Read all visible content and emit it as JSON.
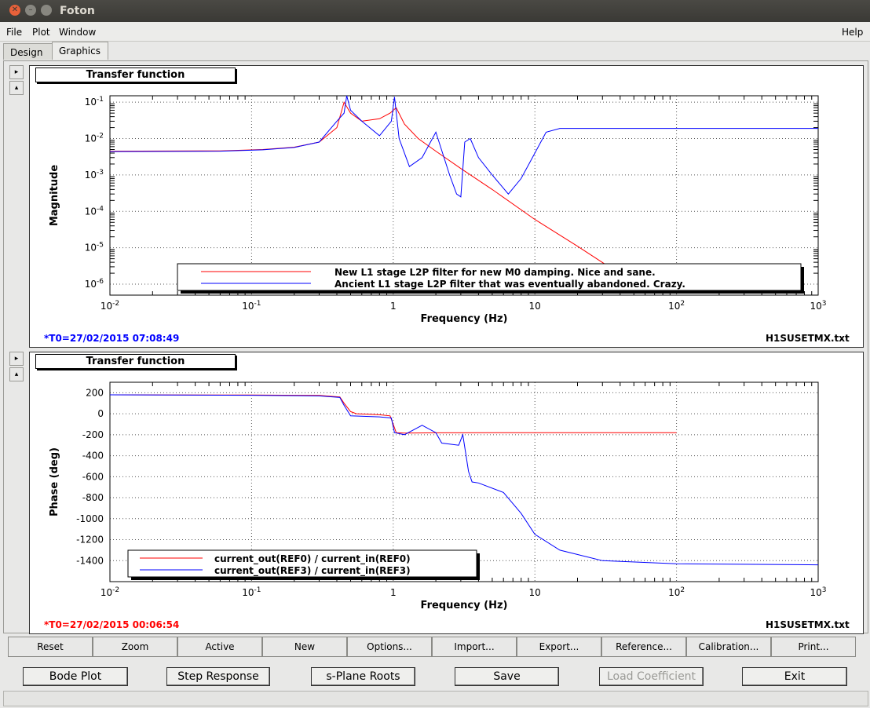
{
  "window": {
    "title": "Foton"
  },
  "menu": {
    "file": "File",
    "plot": "Plot",
    "window": "Window",
    "help": "Help"
  },
  "tabs": [
    {
      "label": "Design"
    },
    {
      "label": "Graphics"
    }
  ],
  "side_buttons": {
    "expand": "▸",
    "collapse": "▴"
  },
  "plots": [
    {
      "panel_title": "Transfer function",
      "t0": "*T0=27/02/2015 07:08:49",
      "t0_color": "#0000ff",
      "file": "H1SUSETMX.txt",
      "chart_data": {
        "type": "line",
        "ylabel": "Magnitude",
        "xlabel": "Frequency (Hz)",
        "xscale": "log",
        "yscale": "log",
        "xlim": [
          0.01,
          1000
        ],
        "ylim": [
          5e-07,
          0.15
        ],
        "x_ticks": [
          "10-2",
          "10-1",
          "1",
          "10",
          "102",
          "103"
        ],
        "y_ticks": [
          "10-1",
          "10-2",
          "10-3",
          "10-4",
          "10-5",
          "10-6"
        ],
        "grid": true,
        "legend": "bottom-center",
        "series": [
          {
            "name": "New L1 stage L2P filter for new M0 damping. Nice and sane.",
            "color": "#ff0000",
            "x": [
              0.01,
              0.06,
              0.12,
              0.2,
              0.3,
              0.4,
              0.45,
              0.5,
              0.6,
              0.8,
              0.95,
              1.05,
              1.2,
              1.5,
              2,
              3,
              5,
              10,
              20,
              40
            ],
            "y": [
              0.0045,
              0.0046,
              0.005,
              0.0058,
              0.008,
              0.02,
              0.1,
              0.05,
              0.03,
              0.035,
              0.05,
              0.07,
              0.025,
              0.01,
              0.0045,
              0.0015,
              0.0004,
              6e-05,
              1.1e-05,
              1.9e-06
            ]
          },
          {
            "name": "Ancient L1 stage L2P filter that was eventually abandoned. Crazy.",
            "color": "#0000ff",
            "x": [
              0.01,
              0.06,
              0.12,
              0.2,
              0.3,
              0.4,
              0.45,
              0.47,
              0.5,
              0.6,
              0.8,
              0.97,
              1.02,
              1.1,
              1.3,
              1.6,
              2,
              2.5,
              2.8,
              3,
              3.2,
              3.5,
              4,
              5,
              6.5,
              8,
              10,
              12,
              15,
              30,
              100,
              1000
            ],
            "y": [
              0.0044,
              0.0045,
              0.0049,
              0.0057,
              0.008,
              0.03,
              0.05,
              0.15,
              0.06,
              0.03,
              0.012,
              0.03,
              0.14,
              0.01,
              0.0017,
              0.003,
              0.015,
              0.001,
              0.0003,
              0.00025,
              0.008,
              0.01,
              0.003,
              0.001,
              0.0003,
              0.0008,
              0.004,
              0.015,
              0.019,
              0.019,
              0.019,
              0.019
            ]
          }
        ]
      }
    },
    {
      "panel_title": "Transfer function",
      "t0": "*T0=27/02/2015 00:06:54",
      "t0_color": "#ff0000",
      "file": "H1SUSETMX.txt",
      "chart_data": {
        "type": "line",
        "ylabel": "Phase (deg)",
        "xlabel": "Frequency (Hz)",
        "xscale": "log",
        "yscale": "linear",
        "xlim": [
          0.01,
          1000
        ],
        "ylim": [
          -1600,
          300
        ],
        "x_ticks": [
          "10-2",
          "10-1",
          "1",
          "10",
          "102",
          "103"
        ],
        "y_ticks": [
          200,
          0,
          -200,
          -400,
          -600,
          -800,
          -1000,
          -1200,
          -1400
        ],
        "grid": true,
        "legend": "bottom-left",
        "series": [
          {
            "name": "current_out(REF0) / current_in(REF0)",
            "color": "#ff0000",
            "x": [
              0.01,
              0.1,
              0.3,
              0.42,
              0.45,
              0.5,
              0.55,
              0.8,
              0.95,
              1.0,
              1.05,
              1.2,
              2,
              10,
              100
            ],
            "y": [
              180,
              178,
              175,
              160,
              100,
              20,
              0,
              -10,
              -20,
              -100,
              -180,
              -185,
              -182,
              -180,
              -180
            ]
          },
          {
            "name": "current_out(REF3) / current_in(REF3)",
            "color": "#0000ff",
            "x": [
              0.01,
              0.1,
              0.3,
              0.42,
              0.45,
              0.5,
              0.8,
              0.97,
              1.02,
              1.2,
              1.6,
              2,
              2.2,
              2.9,
              3.1,
              3.4,
              3.6,
              4,
              6,
              8,
              10,
              15,
              30,
              100,
              1000
            ],
            "y": [
              180,
              176,
              170,
              155,
              80,
              -20,
              -30,
              -40,
              -180,
              -200,
              -110,
              -180,
              -280,
              -300,
              -200,
              -550,
              -650,
              -660,
              -750,
              -950,
              -1150,
              -1300,
              -1400,
              -1430,
              -1440
            ]
          }
        ]
      }
    }
  ],
  "toolbar": [
    "Reset",
    "Zoom",
    "Active",
    "New",
    "Options...",
    "Import...",
    "Export...",
    "Reference...",
    "Calibration...",
    "Print..."
  ],
  "bottom_buttons": {
    "bode": "Bode Plot",
    "step": "Step Response",
    "splane": "s-Plane Roots",
    "save": "Save",
    "load": "Load Coefficient",
    "exit": "Exit"
  }
}
